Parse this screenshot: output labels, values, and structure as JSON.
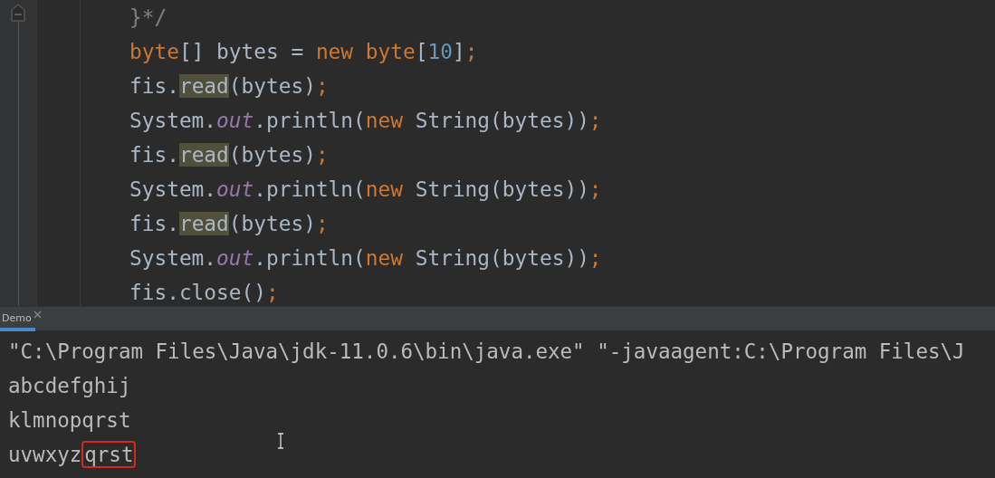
{
  "editor": {
    "lines": [
      [
        {
          "kind": "comment",
          "text": "}*/"
        }
      ],
      [
        {
          "kind": "keyword",
          "text": "byte"
        },
        {
          "kind": "plain",
          "text": "[] bytes = "
        },
        {
          "kind": "keyword",
          "text": "new "
        },
        {
          "kind": "keyword",
          "text": "byte"
        },
        {
          "kind": "plain",
          "text": "["
        },
        {
          "kind": "number",
          "text": "10"
        },
        {
          "kind": "plain",
          "text": "]"
        },
        {
          "kind": "keyword",
          "text": ";"
        }
      ],
      [
        {
          "kind": "plain",
          "text": "fis."
        },
        {
          "kind": "usage",
          "text": "read"
        },
        {
          "kind": "plain",
          "text": "(bytes)"
        },
        {
          "kind": "keyword",
          "text": ";"
        }
      ],
      [
        {
          "kind": "plain",
          "text": "System."
        },
        {
          "kind": "field",
          "text": "out"
        },
        {
          "kind": "plain",
          "text": ".println("
        },
        {
          "kind": "keyword",
          "text": "new "
        },
        {
          "kind": "plain",
          "text": "String(bytes))"
        },
        {
          "kind": "keyword",
          "text": ";"
        }
      ],
      [
        {
          "kind": "plain",
          "text": "fis."
        },
        {
          "kind": "usage",
          "text": "read"
        },
        {
          "kind": "plain",
          "text": "(bytes)"
        },
        {
          "kind": "keyword",
          "text": ";"
        }
      ],
      [
        {
          "kind": "plain",
          "text": "System."
        },
        {
          "kind": "field",
          "text": "out"
        },
        {
          "kind": "plain",
          "text": ".println("
        },
        {
          "kind": "keyword",
          "text": "new "
        },
        {
          "kind": "plain",
          "text": "String(bytes))"
        },
        {
          "kind": "keyword",
          "text": ";"
        }
      ],
      [
        {
          "kind": "plain",
          "text": "fis."
        },
        {
          "kind": "usage",
          "text": "read"
        },
        {
          "kind": "plain",
          "text": "(bytes)"
        },
        {
          "kind": "keyword",
          "text": ";"
        }
      ],
      [
        {
          "kind": "plain",
          "text": "System."
        },
        {
          "kind": "field",
          "text": "out"
        },
        {
          "kind": "plain",
          "text": ".println("
        },
        {
          "kind": "keyword",
          "text": "new "
        },
        {
          "kind": "plain",
          "text": "String(bytes))"
        },
        {
          "kind": "keyword",
          "text": ";"
        }
      ],
      [
        {
          "kind": "plain",
          "text": "fis.close()"
        },
        {
          "kind": "keyword",
          "text": ";"
        }
      ]
    ]
  },
  "console": {
    "tabs": [
      {
        "label": "Demo",
        "selected": true,
        "closable": true
      }
    ],
    "lines": [
      [
        {
          "text": "\"C:\\Program Files\\Java\\jdk-11.0.6\\bin\\java.exe\" \"-javaagent:C:\\Program Files\\J",
          "circled": false
        }
      ],
      [
        {
          "text": "abcdefghij",
          "circled": false
        }
      ],
      [
        {
          "text": "klmnopqrst",
          "circled": false
        }
      ],
      [
        {
          "text": "uvwxyz",
          "circled": false
        },
        {
          "text": "qrst",
          "circled": true
        }
      ]
    ]
  }
}
